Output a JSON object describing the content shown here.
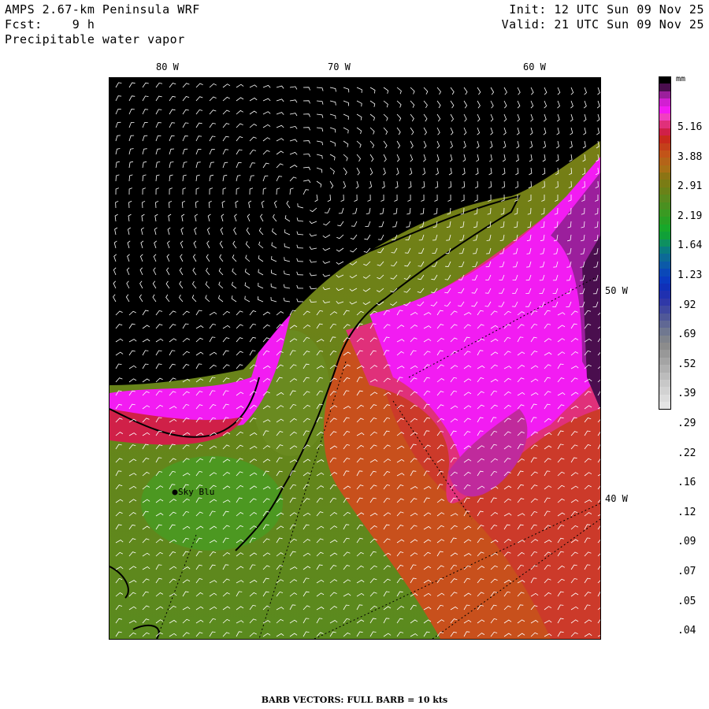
{
  "header": {
    "model": "AMPS 2.67-km Peninsula WRF",
    "forecast": "Fcst:    9 h",
    "field": "Precipitable water vapor",
    "init": "Init: 12 UTC Sun 09 Nov 25",
    "valid": "Valid: 21 UTC Sun 09 Nov 25"
  },
  "longitude_labels": [
    "80 W",
    "70 W",
    "60 W"
  ],
  "latitude_labels": [
    "50 W",
    "40 W"
  ],
  "station": {
    "name": "Sky Blu"
  },
  "legend": {
    "unit": "mm",
    "ticks": [
      "5.16",
      "3.88",
      "2.91",
      "2.19",
      "1.64",
      "1.23",
      ".92",
      ".69",
      ".52",
      ".39",
      ".29",
      ".22",
      ".16",
      ".12",
      ".09",
      ".07",
      ".05",
      ".04"
    ],
    "colors": [
      "#000000",
      "#4a0e4e",
      "#9b1f9c",
      "#d21fd2",
      "#f21cf2",
      "#f040c0",
      "#e0307a",
      "#d02048",
      "#c82a1c",
      "#c4401a",
      "#c25418",
      "#b46418",
      "#a87016",
      "#8c7414",
      "#7a7c14",
      "#6a8218",
      "#5a8a1e",
      "#4a9020",
      "#3a9a22",
      "#28a024",
      "#18a82a",
      "#10a038",
      "#0e9060",
      "#0a7c80",
      "#0c6a96",
      "#0c5aa8",
      "#0a48b8",
      "#0a3ac0",
      "#1030b8",
      "#2030b0",
      "#3038a8",
      "#4048a0",
      "#505898",
      "#606894",
      "#707890",
      "#80848c",
      "#8c8c8c",
      "#989898",
      "#a4a4a4",
      "#b0b0b0",
      "#bcbcbc",
      "#c8c8c8",
      "#d2d2d2",
      "#dcdcdc",
      "#e4e4e4"
    ]
  },
  "footer": "BARB VECTORS:  FULL BARB = 10 kts"
}
